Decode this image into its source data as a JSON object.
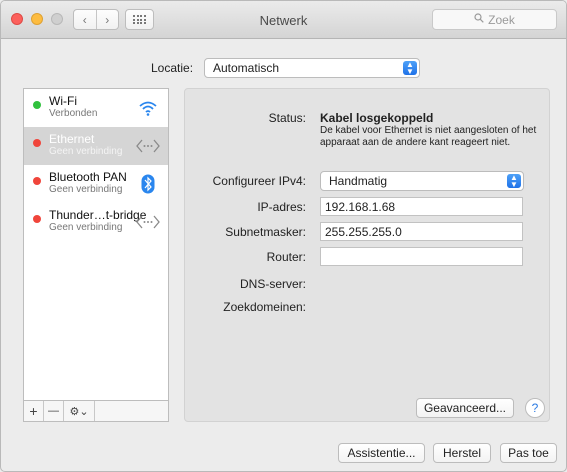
{
  "window": {
    "title": "Netwerk"
  },
  "toolbar": {
    "back_glyph": "‹",
    "forward_glyph": "›",
    "search_placeholder": "Zoek",
    "search_icon": "search-icon"
  },
  "location": {
    "label": "Locatie:",
    "value": "Automatisch"
  },
  "services": [
    {
      "name": "Wi-Fi",
      "status": "Verbonden",
      "dot_color": "#30c13d",
      "icon": "wifi-icon",
      "selected": false
    },
    {
      "name": "Ethernet",
      "status": "Geen verbinding",
      "dot_color": "#f0453b",
      "icon": "ethernet-icon",
      "selected": true
    },
    {
      "name": "Bluetooth PAN",
      "status": "Geen verbinding",
      "dot_color": "#f0453b",
      "icon": "bluetooth-icon",
      "selected": false
    },
    {
      "name": "Thunder…t-bridge",
      "status": "Geen verbinding",
      "dot_color": "#f0453b",
      "icon": "thunderbolt-bridge-icon",
      "selected": false
    }
  ],
  "sidebar_buttons": {
    "add": "+",
    "remove": "—",
    "action": "⚙⌄"
  },
  "detail": {
    "status_label": "Status:",
    "status_value": "Kabel losgekoppeld",
    "status_description": "De kabel voor Ethernet is niet aangesloten of het apparaat aan de andere kant reageert niet.",
    "ipv4_label": "Configureer IPv4:",
    "ipv4_value": "Handmatig",
    "ip_label": "IP-adres:",
    "ip_value": "192.168.1.68",
    "subnet_label": "Subnetmasker:",
    "subnet_value": "255.255.255.0",
    "router_label": "Router:",
    "router_value": "",
    "dns_label": "DNS-server:",
    "search_domains_label": "Zoekdomeinen:",
    "advanced_button": "Geavanceerd...",
    "help_button": "?"
  },
  "footer": {
    "assistant_button": "Assistentie...",
    "revert_button": "Herstel",
    "apply_button": "Pas toe"
  },
  "colors": {
    "accent": "#2a7ae2",
    "selected_row": "#d5d5d5"
  }
}
